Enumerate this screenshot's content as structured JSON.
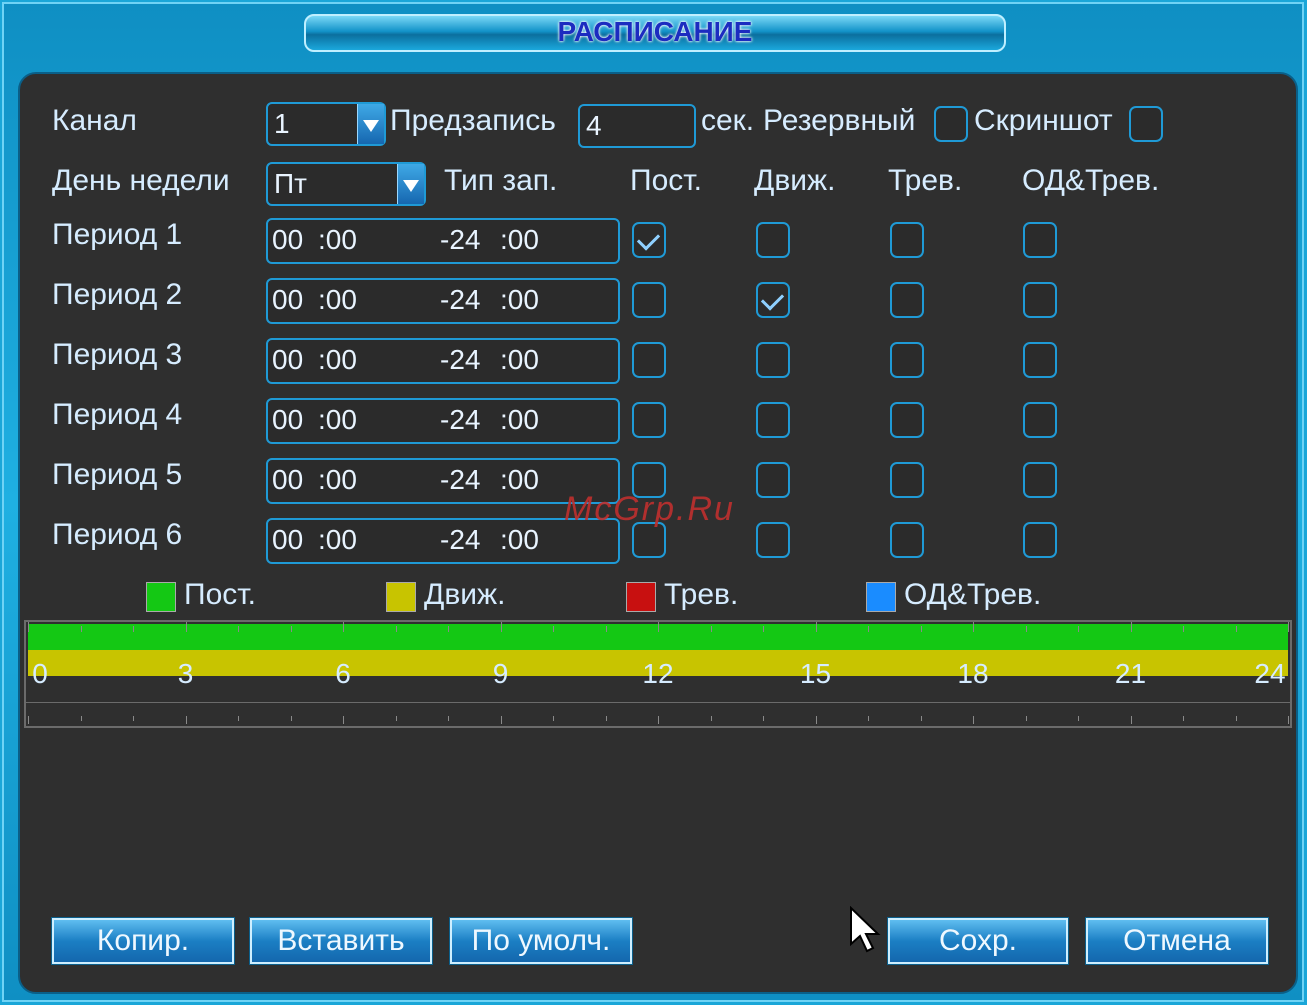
{
  "window": {
    "title": "РАСПИСАНИЕ"
  },
  "row1": {
    "channel_label": "Канал",
    "channel_value": "1",
    "prerecord_label": "Предзапись",
    "prerecord_value": "4",
    "seconds_label": "сек.",
    "backup_label": "Резервный",
    "backup_checked": false,
    "snapshot_label": "Скриншот",
    "snapshot_checked": false
  },
  "row2": {
    "weekday_label": "День недели",
    "weekday_value": "Пт",
    "rectype_label": "Тип зап.",
    "col_regular": "Пост.",
    "col_motion": "Движ.",
    "col_alarm": "Трев.",
    "col_md_alarm": "ОД&Трев."
  },
  "periods": [
    {
      "label": "Период 1",
      "start_h": "00",
      "start_m": ":00",
      "end_h": "-24",
      "end_m": ":00",
      "regular": true,
      "motion": false,
      "alarm": false,
      "md_alarm": false
    },
    {
      "label": "Период 2",
      "start_h": "00",
      "start_m": ":00",
      "end_h": "-24",
      "end_m": ":00",
      "regular": false,
      "motion": true,
      "alarm": false,
      "md_alarm": false
    },
    {
      "label": "Период 3",
      "start_h": "00",
      "start_m": ":00",
      "end_h": "-24",
      "end_m": ":00",
      "regular": false,
      "motion": false,
      "alarm": false,
      "md_alarm": false
    },
    {
      "label": "Период 4",
      "start_h": "00",
      "start_m": ":00",
      "end_h": "-24",
      "end_m": ":00",
      "regular": false,
      "motion": false,
      "alarm": false,
      "md_alarm": false
    },
    {
      "label": "Период 5",
      "start_h": "00",
      "start_m": ":00",
      "end_h": "-24",
      "end_m": ":00",
      "regular": false,
      "motion": false,
      "alarm": false,
      "md_alarm": false
    },
    {
      "label": "Период 6",
      "start_h": "00",
      "start_m": ":00",
      "end_h": "-24",
      "end_m": ":00",
      "regular": false,
      "motion": false,
      "alarm": false,
      "md_alarm": false
    }
  ],
  "legend": [
    {
      "label": "Пост.",
      "color": "#14c814"
    },
    {
      "label": "Движ.",
      "color": "#c8c400"
    },
    {
      "label": "Трев.",
      "color": "#c81010"
    },
    {
      "label": "ОД&Трев.",
      "color": "#1a8cff"
    }
  ],
  "timeline": {
    "hours": [
      "0",
      "3",
      "6",
      "9",
      "12",
      "15",
      "18",
      "21",
      "24"
    ],
    "regular_range": [
      0,
      24
    ],
    "motion_range": [
      0,
      24
    ]
  },
  "buttons": {
    "copy": "Копир.",
    "paste": "Вставить",
    "default": "По умолч.",
    "save": "Сохр.",
    "cancel": "Отмена"
  },
  "watermark": "McGrp.Ru"
}
